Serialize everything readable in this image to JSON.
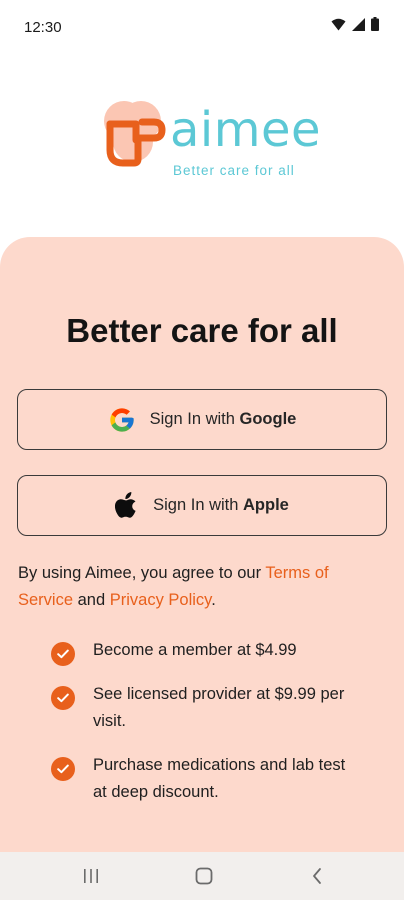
{
  "status_bar": {
    "time": "12:30",
    "icons": [
      "wifi-icon",
      "signal-icon",
      "battery-icon"
    ]
  },
  "logo": {
    "wordmark": "aimee",
    "tagline": "Better care for all",
    "colors": {
      "wordmark": "#5cc8d5",
      "mark_outline": "#e8601c",
      "mark_fill": "#fbc6b3"
    }
  },
  "sheet": {
    "title": "Better care for all",
    "background": "#fdd9cc"
  },
  "signin": {
    "google": {
      "prefix": "Sign In with ",
      "provider": "Google",
      "icon": "google-icon"
    },
    "apple": {
      "prefix": "Sign In with ",
      "provider": "Apple",
      "icon": "apple-icon"
    }
  },
  "terms": {
    "prefix": "By using Aimee, you agree to our ",
    "terms_link": "Terms of Service",
    "middle": " and ",
    "privacy_link": "Privacy Policy",
    "suffix": ".",
    "link_color": "#e8601c"
  },
  "benefits": [
    {
      "text": "Become a member at $4.99",
      "icon": "check-icon"
    },
    {
      "text": "See licensed provider at $9.99 per visit.",
      "icon": "check-icon"
    },
    {
      "text": "Purchase medications and lab test at deep discount.",
      "icon": "check-icon"
    }
  ],
  "nav_bar": {
    "buttons": [
      "recent-apps-icon",
      "home-icon",
      "back-icon"
    ]
  }
}
